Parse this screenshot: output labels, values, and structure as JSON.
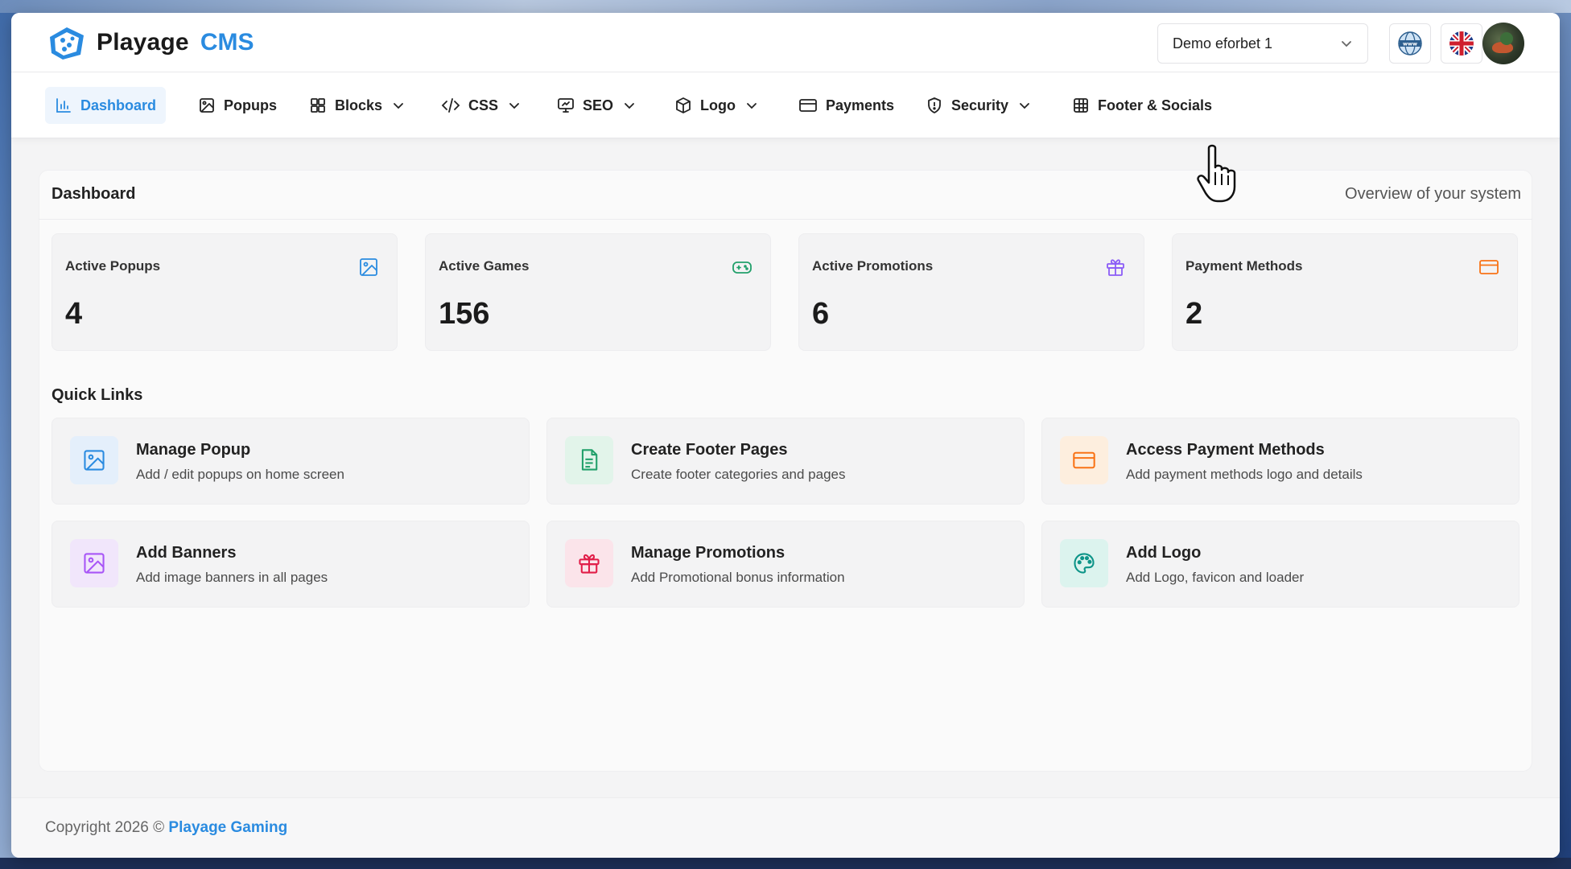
{
  "app": {
    "brand_name": "Playage",
    "brand_accent": "CMS"
  },
  "header": {
    "site_selector_value": "Demo eforbet 1",
    "globe_icon": "globe-icon",
    "language_flag": "uk-flag-icon",
    "avatar": "user-avatar"
  },
  "nav": {
    "items": [
      {
        "label": "Dashboard",
        "icon": "bar-chart-icon",
        "has_dropdown": false,
        "active": true
      },
      {
        "label": "Popups",
        "icon": "image-icon",
        "has_dropdown": false
      },
      {
        "label": "Blocks",
        "icon": "grid-icon",
        "has_dropdown": true
      },
      {
        "label": "CSS",
        "icon": "code-icon",
        "has_dropdown": true
      },
      {
        "label": "SEO",
        "icon": "monitor-icon",
        "has_dropdown": true
      },
      {
        "label": "Logo",
        "icon": "box-icon",
        "has_dropdown": true
      },
      {
        "label": "Payments",
        "icon": "credit-card-icon",
        "has_dropdown": false
      },
      {
        "label": "Security",
        "icon": "shield-icon",
        "has_dropdown": true
      },
      {
        "label": "Footer & Socials",
        "icon": "table-icon",
        "has_dropdown": false
      }
    ]
  },
  "dashboard": {
    "title": "Dashboard",
    "subtitle": "Overview of your system",
    "stats": [
      {
        "label": "Active Popups",
        "value": "4",
        "icon": "image-icon",
        "color": "#2a8be0"
      },
      {
        "label": "Active Games",
        "value": "156",
        "icon": "gamepad-icon",
        "color": "#22a06b"
      },
      {
        "label": "Active Promotions",
        "value": "6",
        "icon": "gift-icon",
        "color": "#8b5cf6"
      },
      {
        "label": "Payment Methods",
        "value": "2",
        "icon": "credit-card-icon",
        "color": "#f97316"
      }
    ],
    "quick_links_title": "Quick Links",
    "quick_links": [
      {
        "title": "Manage Popup",
        "desc": "Add / edit popups on home screen",
        "icon": "image-icon",
        "color": "#2a8be0",
        "bg": "#e4effb"
      },
      {
        "title": "Create Footer Pages",
        "desc": "Create footer categories and pages",
        "icon": "document-icon",
        "color": "#22a06b",
        "bg": "#e2f4ea"
      },
      {
        "title": "Access Payment Methods",
        "desc": "Add payment methods logo and details",
        "icon": "credit-card-icon",
        "color": "#f97316",
        "bg": "#fdeede"
      },
      {
        "title": "Add Banners",
        "desc": "Add image banners in all pages",
        "icon": "image-icon",
        "color": "#a855f7",
        "bg": "#f1e6fb"
      },
      {
        "title": "Manage Promotions",
        "desc": "Add Promotional bonus information",
        "icon": "gift-icon",
        "color": "#e11d48",
        "bg": "#fbe4ea"
      },
      {
        "title": "Add Logo",
        "desc": "Add Logo, favicon and loader",
        "icon": "palette-icon",
        "color": "#0d9488",
        "bg": "#dcf3ee"
      }
    ]
  },
  "footer": {
    "copyright": "Copyright 2026 © ",
    "company": "Playage Gaming"
  }
}
